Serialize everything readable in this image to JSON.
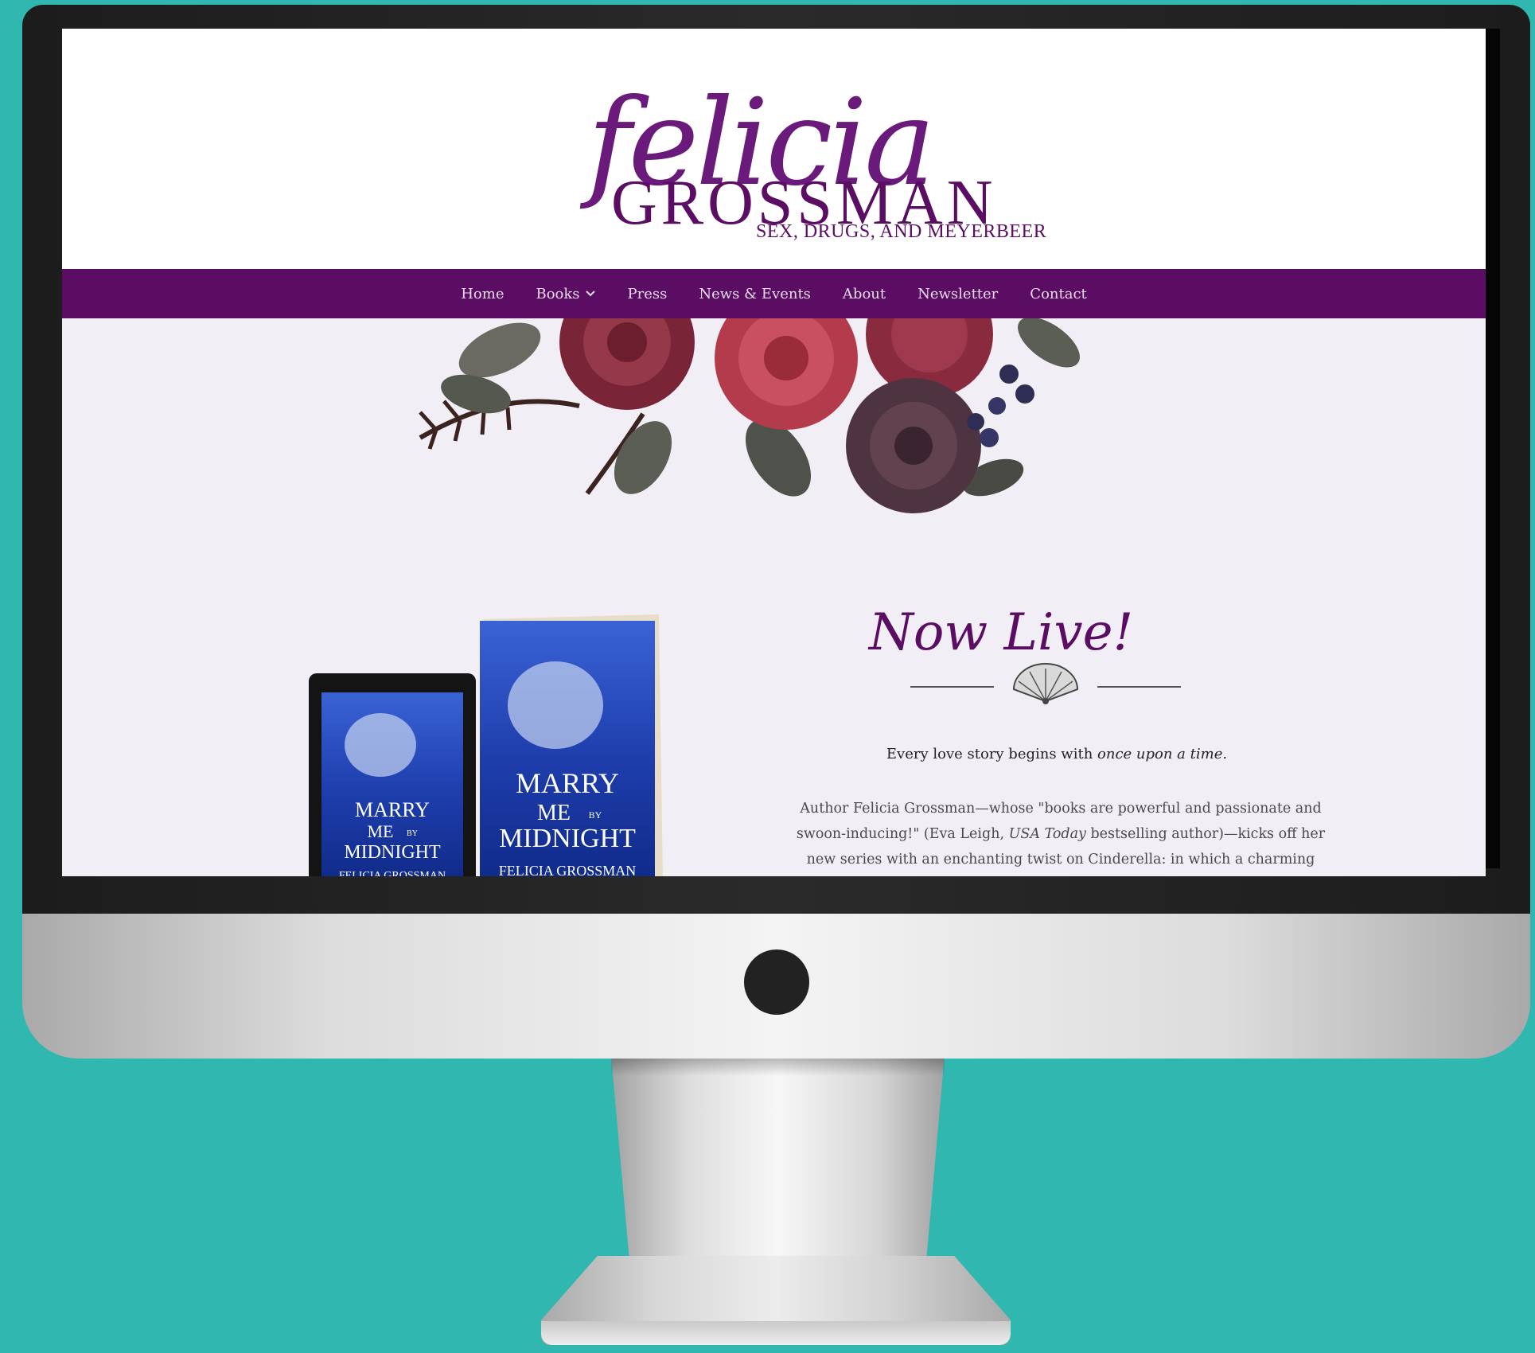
{
  "brand": {
    "script_name": "felicia",
    "name": "GROSSMAN",
    "tagline": "SEX, DRUGS, AND MEYERBEER"
  },
  "nav": {
    "items": [
      "Home",
      "Books",
      "Press",
      "News & Events",
      "About",
      "Newsletter",
      "Contact"
    ]
  },
  "hero": {
    "heading": "Now Live!",
    "tagline_start": "Every love story begins with ",
    "tagline_em": "once upon a time.",
    "desc_part1": "Author Felicia Grossman—whose \"books are powerful and passionate and swoon-inducing!\" (Eva Leigh, ",
    "desc_em": "USA Today",
    "desc_part2": " bestselling author)—kicks off her new series with an enchanting twist on Cinderella: in which a charming"
  },
  "book": {
    "title_line1": "MARRY",
    "title_line2": "ME",
    "title_by": "BY",
    "title_line3": "MIDNIGHT",
    "author": "FELICIA GROSSMAN"
  },
  "colors": {
    "background": "#2fb7b0",
    "brand_purple": "#5a0d63",
    "page_bg": "#f2eef5"
  }
}
